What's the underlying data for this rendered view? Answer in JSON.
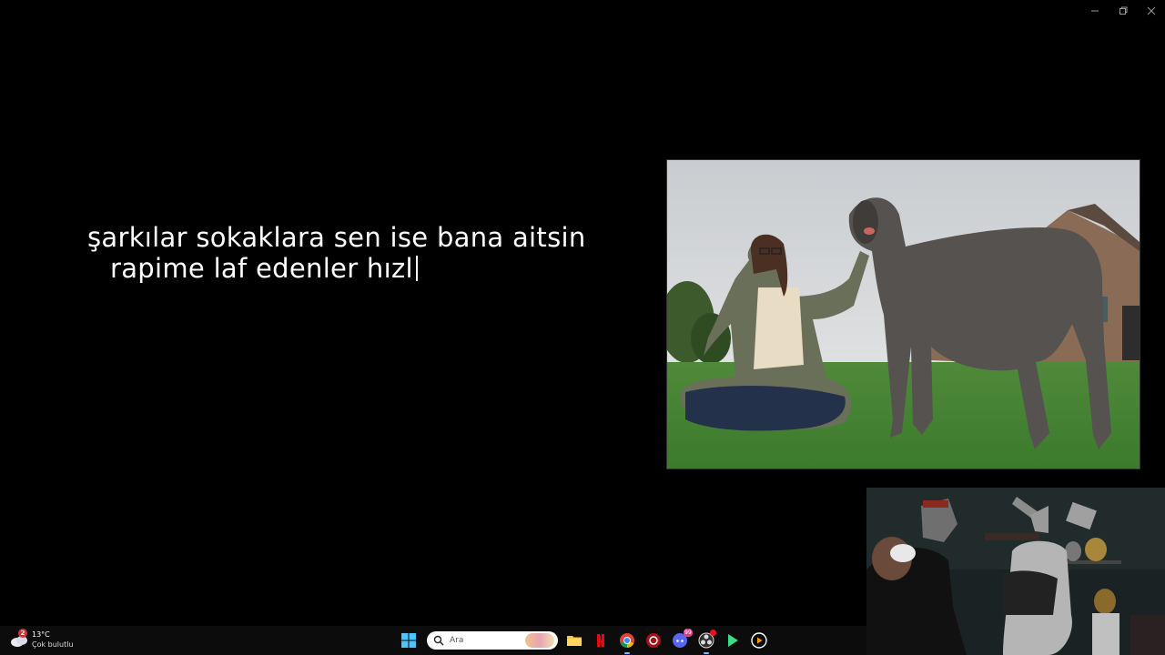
{
  "window": {
    "controls": [
      "minimize",
      "restore",
      "close"
    ]
  },
  "lyrics": {
    "line1": "şarkılar sokaklara sen ise bana aitsin",
    "line2": "rapime laf edenler hızl"
  },
  "photo": {
    "icon": "photo-woman-and-great-dane"
  },
  "webcam": {
    "icon": "webcam-feed"
  },
  "taskbar": {
    "weather": {
      "badge": "2",
      "temp": "13°C",
      "desc": "Çok bulutlu"
    },
    "search": {
      "placeholder": "Ara"
    },
    "apps": [
      {
        "name": "start",
        "icon": "windows-logo-icon"
      },
      {
        "name": "file-explorer",
        "icon": "folder-icon"
      },
      {
        "name": "netflix",
        "icon": "netflix-icon"
      },
      {
        "name": "chrome",
        "icon": "chrome-icon"
      },
      {
        "name": "game-launcher",
        "icon": "red-circle-icon"
      },
      {
        "name": "discord",
        "icon": "discord-icon",
        "badge": "99"
      },
      {
        "name": "obs",
        "icon": "obs-icon"
      },
      {
        "name": "media-player",
        "icon": "play-icon"
      },
      {
        "name": "video-player",
        "icon": "play-circle-icon"
      }
    ],
    "colors": {
      "taskbar_bg": "#0c0c0c",
      "accent": "#7ab7ff",
      "badge_red": "#d13438"
    }
  }
}
